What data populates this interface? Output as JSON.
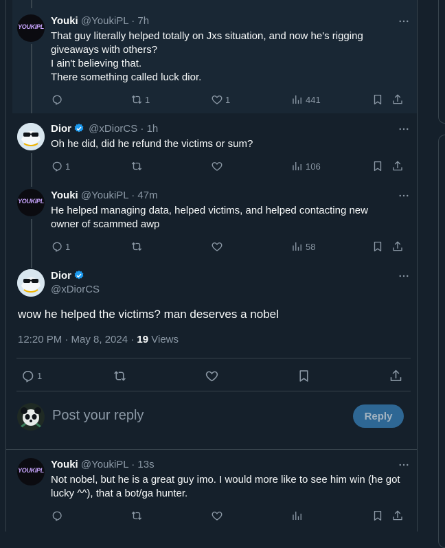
{
  "tweets": [
    {
      "name": "Youki",
      "handle": "@YoukiPL",
      "time": "· 7h",
      "avatar_text": "YOUKIPL",
      "lines": [
        "That guy literally helped totally on Jxs situation, and now he's rigging",
        "giveaways with others?",
        "I ain't believing that.",
        "There something called luck dior."
      ],
      "replies": "",
      "reposts": "1",
      "likes": "1",
      "views": "441"
    },
    {
      "name": "Dior",
      "handle": "@xDiorCS",
      "time": "· 1h",
      "lines": [
        "Oh he did, did he refund the victims or sum?"
      ],
      "replies": "1",
      "reposts": "",
      "likes": "",
      "views": "106"
    },
    {
      "name": "Youki",
      "handle": "@YoukiPL",
      "time": "· 47m",
      "avatar_text": "YOUKIPL",
      "lines": [
        "He helped managing data, helped victims, and helped contacting new",
        "owner of scammed awp"
      ],
      "replies": "1",
      "reposts": "",
      "likes": "",
      "views": "58"
    }
  ],
  "focused": {
    "name": "Dior",
    "handle": "@xDiorCS",
    "text": "wow he helped the victims? man deserves a nobel",
    "timestamp": "12:20 PM · May 8, 2024 · ",
    "views_count": "19",
    "views_label": " Views",
    "replies": "1"
  },
  "composer": {
    "placeholder": "Post your reply",
    "reply_button": "Reply"
  },
  "reply": {
    "name": "Youki",
    "handle": "@YoukiPL",
    "time": "· 13s",
    "avatar_text": "YOUKIPL",
    "lines": [
      "Not nobel, but he is a great guy imo. I would more like to see him win (he got",
      "lucky ^^), that a bot/ga hunter."
    ]
  },
  "colors": {
    "background": "#15202b",
    "text": "#f7f9f9",
    "muted": "#8b98a5",
    "accent": "#1d9bf0",
    "border": "#38444d"
  },
  "icons": [
    "reply-icon",
    "repost-icon",
    "like-icon",
    "views-icon",
    "bookmark-icon",
    "share-icon",
    "more-icon",
    "verified-icon"
  ]
}
